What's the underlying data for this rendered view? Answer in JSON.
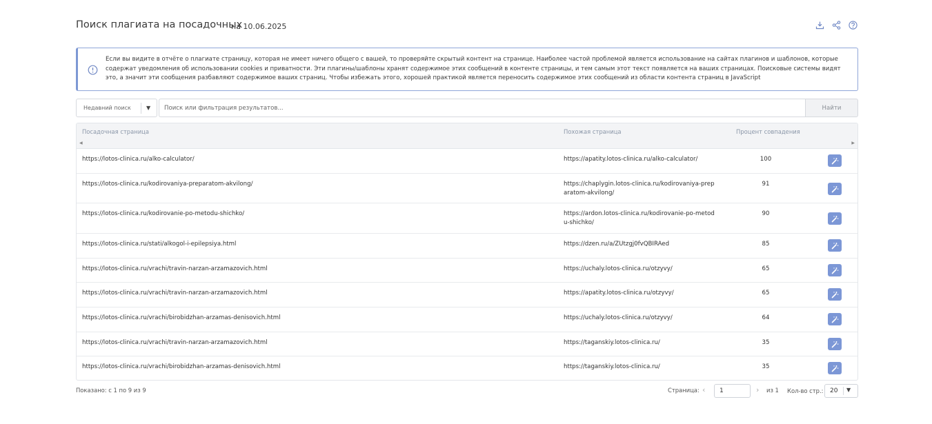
{
  "header": {
    "title": "Поиск плагиата на посадочных",
    "date": "на 10.06.2025",
    "icons": [
      "download-icon",
      "share-icon",
      "help-icon"
    ]
  },
  "notice": {
    "icon": "info-icon",
    "text": "Если вы видите в отчёте о плагиате страницу, которая не имеет ничего общего с вашей, то проверяйте скрытый контент на странице. Наиболее частой проблемой является использование на сайтах плагинов и шаблонов, которые содержат уведомления об использовании cookies и приватности. Эти плагины/шаблоны хранят содержимое этих сообщений в контенте страницы, и тем самым этот текст появляется на ваших страницах. Поисковые системы видят это, а значит эти сообщения разбавляют содержимое ваших страниц. Чтобы избежать этого, хорошей практикой является переносить содержимое этих сообщений из области контента страниц в JavaScript"
  },
  "search": {
    "recent_label": "Недавний поиск",
    "placeholder": "Поиск или фильтрация результатов...",
    "button_label": "Найти"
  },
  "table": {
    "columns": [
      "Посадочная страница",
      "Похожая страница",
      "Процент совпадения"
    ],
    "rows": [
      {
        "landing": "https://lotos-clinica.ru/alko-calculator/",
        "similar": "https://apatity.lotos-clinica.ru/alko-calculator/",
        "percent": "100"
      },
      {
        "landing": "https://lotos-clinica.ru/kodirovaniya-preparatom-akvilong/",
        "similar": "https://chaplygin.lotos-clinica.ru/kodirovaniya-preparatom-akvilong/",
        "percent": "91"
      },
      {
        "landing": "https://lotos-clinica.ru/kodirovanie-po-metodu-shichko/",
        "similar": "https://ardon.lotos-clinica.ru/kodirovanie-po-metodu-shichko/",
        "percent": "90"
      },
      {
        "landing": "https://lotos-clinica.ru/stati/alkogol-i-epilepsiya.html",
        "similar": "https://dzen.ru/a/ZUtzgj0fvQBIRAed",
        "percent": "85"
      },
      {
        "landing": "https://lotos-clinica.ru/vrachi/travin-narzan-arzamazovich.html",
        "similar": "https://uchaly.lotos-clinica.ru/otzyvy/",
        "percent": "65"
      },
      {
        "landing": "https://lotos-clinica.ru/vrachi/travin-narzan-arzamazovich.html",
        "similar": "https://apatity.lotos-clinica.ru/otzyvy/",
        "percent": "65"
      },
      {
        "landing": "https://lotos-clinica.ru/vrachi/birobidzhan-arzamas-denisovich.html",
        "similar": "https://uchaly.lotos-clinica.ru/otzyvy/",
        "percent": "64"
      },
      {
        "landing": "https://lotos-clinica.ru/vrachi/travin-narzan-arzamazovich.html",
        "similar": "https://taganskiy.lotos-clinica.ru/",
        "percent": "35"
      },
      {
        "landing": "https://lotos-clinica.ru/vrachi/birobidzhan-arzamas-denisovich.html",
        "similar": "https://taganskiy.lotos-clinica.ru/",
        "percent": "35"
      }
    ],
    "action_icon": "magic-wand-icon"
  },
  "footer": {
    "shown": "Показано: с 1 по 9 из 9",
    "page_label": "Страница:",
    "page_value": "1",
    "page_of": "из 1",
    "page_size_label": "Кол-во стр.:",
    "page_size_value": "20"
  },
  "colors": {
    "accent": "#7c97d6",
    "notice_border": "#8fa6d8",
    "header_bg": "#f3f4f6"
  }
}
